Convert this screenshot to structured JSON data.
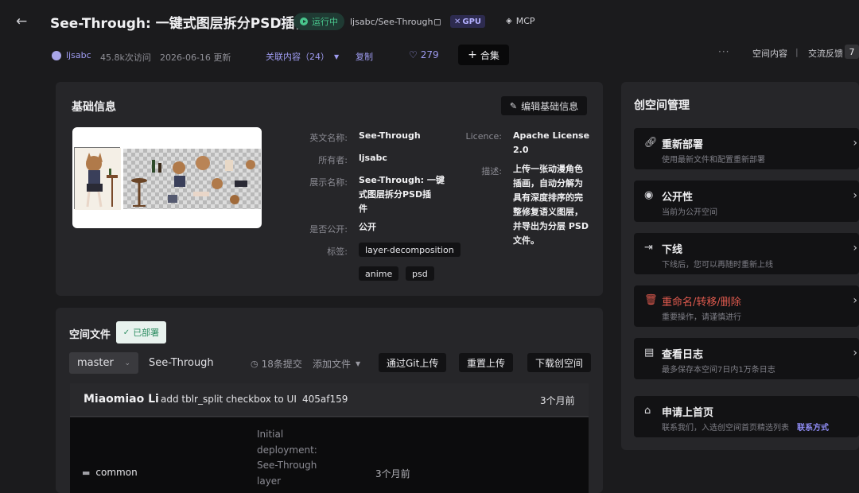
{
  "header": {
    "back_icon": "arrow-left-icon",
    "title": "See-Through: 一键式图层拆分PSD插件",
    "status": "运行中",
    "repo": "ljsabc/See-Through",
    "gpu_badge": "GPU",
    "mcp_label": "MCP",
    "owner": "ljsabc",
    "visits": "45.8k次访问",
    "updated": "2026-06-16 更新",
    "related": "关联内容（24）",
    "copy": "复制",
    "likes": "279",
    "collection": "合集",
    "more": "···",
    "space_content": "空间内容",
    "separator": "|",
    "feedback": "交流反馈",
    "feedback_count": "7"
  },
  "basic_info": {
    "title": "基础信息",
    "edit_button": "编辑基础信息",
    "fields": {
      "english_name_label": "英文名称:",
      "english_name": "See-Through",
      "owner_label": "所有者:",
      "owner": "ljsabc",
      "display_name_label": "展示名称:",
      "display_name_lines": [
        "See-Through: 一键",
        "式图层拆分PSD插",
        "件"
      ],
      "public_label": "是否公开:",
      "public": "公开",
      "tags_label": "标签:",
      "tags": [
        "layer-decomposition",
        "anime",
        "psd"
      ],
      "licence_label": "Licence:",
      "licence_lines": [
        "Apache License",
        "2.0"
      ],
      "desc_label": "描述:",
      "desc_lines": [
        "上传一张动漫角色",
        "插画，自动分解为",
        "具有深度排序的完",
        "整修复语义图层，",
        "并导出为分层 PSD",
        "文件。"
      ]
    }
  },
  "files": {
    "title": "空间文件",
    "deployed": "已部署",
    "branch": "master",
    "space_name": "See-Through",
    "commits": "18条提交",
    "add_file": "添加文件",
    "git_upload": "通过Git上传",
    "reupload": "重置上传",
    "download": "下载创空间",
    "last_commit": {
      "author": "Miaomiao Li",
      "message": "add tblr_split checkbox to UI",
      "hash": "405af159",
      "time": "3个月前"
    },
    "rows": [
      {
        "name": "common",
        "message_lines": [
          "Initial",
          "deployment:",
          "See-Through",
          "layer"
        ],
        "time": "3个月前"
      }
    ]
  },
  "manage": {
    "title": "创空间管理",
    "items": [
      {
        "icon": "link-icon",
        "title": "重新部署",
        "desc": "使用最新文件和配置重新部署",
        "danger": false
      },
      {
        "icon": "eye-icon",
        "title": "公开性",
        "desc": "当前为公开空间",
        "danger": false
      },
      {
        "icon": "exit-icon",
        "title": "下线",
        "desc": "下线后，您可以再随时重新上线",
        "danger": false
      },
      {
        "icon": "trash-icon",
        "title": "重命名/转移/删除",
        "desc": "重要操作，请谨慎进行",
        "danger": true
      },
      {
        "icon": "document-icon",
        "title": "查看日志",
        "desc": "最多保存本空间7日内1万条日志",
        "danger": false
      }
    ],
    "homepage": {
      "title": "申请上首页",
      "desc": "联系我们，入选创空间首页精选列表",
      "link": "联系方式"
    }
  },
  "colors": {
    "background": "#1b1b1d",
    "panel": "#262629",
    "accent": "#8f8cf5",
    "running": "#48c58c",
    "danger": "#e05a4e"
  }
}
